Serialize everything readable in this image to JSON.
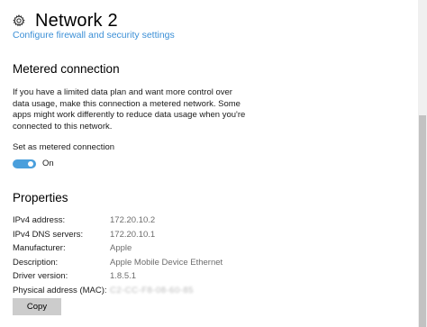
{
  "header": {
    "title": "Network  2",
    "icon": "gear-icon"
  },
  "firewall_link": "Configure firewall and security settings",
  "metered": {
    "heading": "Metered connection",
    "description": "If you have a limited data plan and want more control over data usage, make this connection a metered network. Some apps might work differently to reduce data usage when you're connected to this network.",
    "toggle_label": "Set as metered connection",
    "toggle_state": "On",
    "toggle_on": true,
    "accent_color": "#4a9fdc"
  },
  "properties": {
    "heading": "Properties",
    "rows": [
      {
        "label": "IPv4 address:",
        "value": "172.20.10.2"
      },
      {
        "label": "IPv4 DNS servers:",
        "value": "172.20.10.1"
      },
      {
        "label": "Manufacturer:",
        "value": "Apple"
      },
      {
        "label": "Description:",
        "value": "Apple Mobile Device Ethernet"
      },
      {
        "label": "Driver version:",
        "value": "1.8.5.1"
      },
      {
        "label": "Physical address (MAC):",
        "value": "C2-CC-F8-08-60-85",
        "blurred": true
      }
    ],
    "copy_label": "Copy"
  }
}
